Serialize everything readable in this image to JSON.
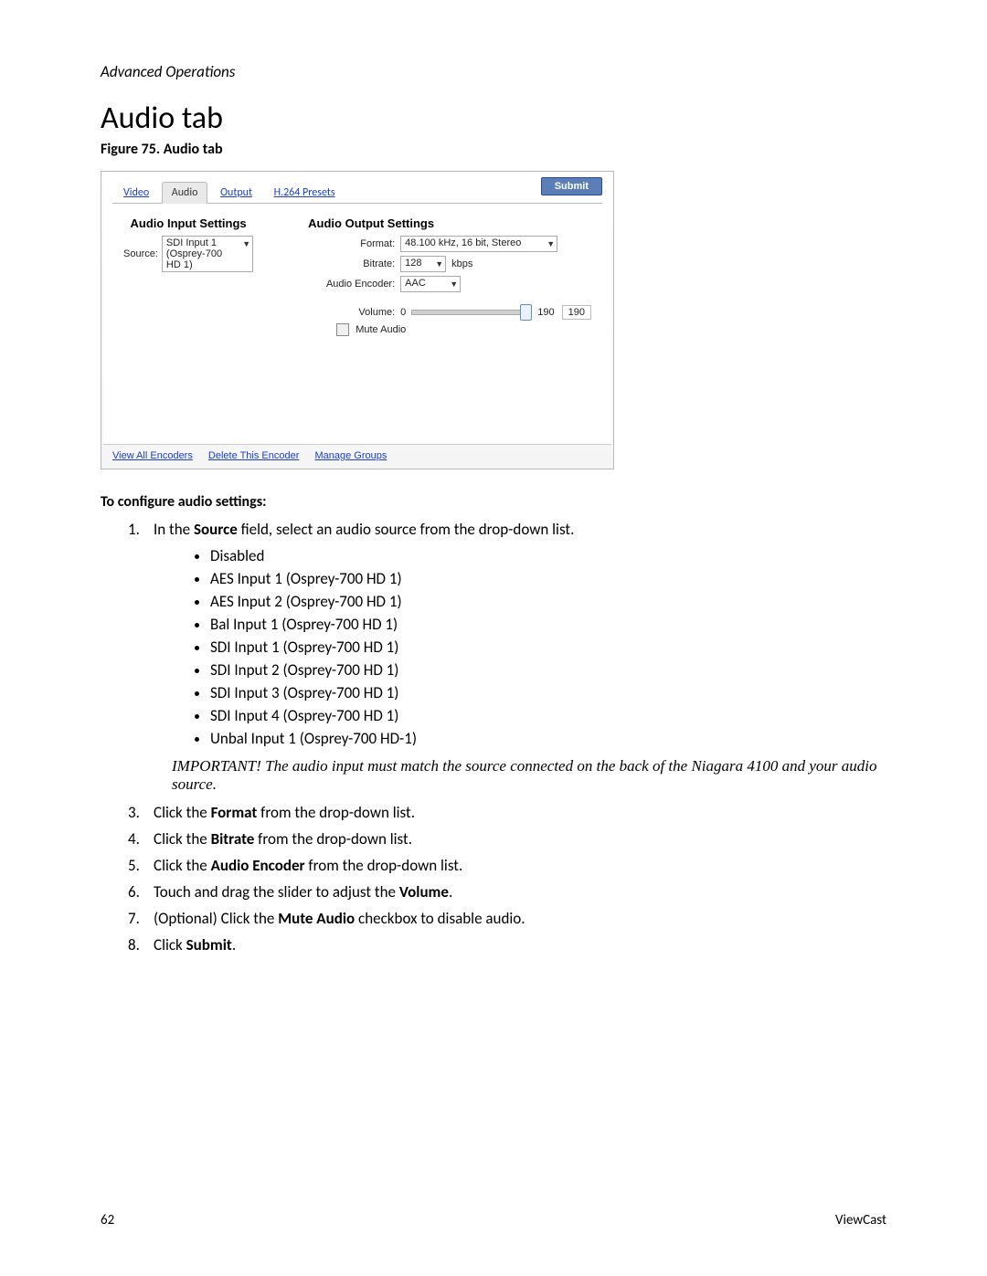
{
  "header": {
    "running": "Advanced Operations"
  },
  "title": "Audio tab",
  "figure_caption": "Figure 75. Audio tab",
  "screenshot": {
    "tabs": {
      "video": "Video",
      "audio": "Audio",
      "output": "Output",
      "presets": "H.264 Presets"
    },
    "submit": "Submit",
    "input": {
      "title": "Audio Input Settings",
      "source_label": "Source:",
      "source_value": "SDI Input 1 (Osprey-700 HD 1)"
    },
    "output": {
      "title": "Audio Output Settings",
      "format_label": "Format:",
      "format_value": "48.100 kHz, 16 bit, Stereo",
      "bitrate_label": "Bitrate:",
      "bitrate_value": "128",
      "bitrate_unit": "kbps",
      "encoder_label": "Audio Encoder:",
      "encoder_value": "AAC",
      "volume_label": "Volume:",
      "volume_min": "0",
      "volume_val": "190",
      "volume_max": "190",
      "mute_label": "Mute Audio"
    },
    "links": {
      "all": "View All Encoders",
      "delete": "Delete This Encoder",
      "groups": "Manage Groups"
    }
  },
  "instructions": {
    "heading": "To configure audio settings:",
    "step1_a": "In the ",
    "step1_b": "Source",
    "step1_c": " field, select an audio source from the drop-down list.",
    "options": [
      "Disabled",
      "AES Input 1 (Osprey-700 HD 1)",
      "AES Input 2 (Osprey-700 HD 1)",
      "Bal Input 1 (Osprey-700 HD 1)",
      "SDI Input 1 (Osprey-700 HD 1)",
      "SDI Input 2 (Osprey-700 HD 1)",
      "SDI Input 3 (Osprey-700 HD 1)",
      "SDI Input 4 (Osprey-700 HD 1)",
      "Unbal Input 1 (Osprey-700 HD-1)"
    ],
    "important": "IMPORTANT! The audio input must match the source connected on the back of the Niagara 4100 and your audio source.",
    "step3_a": "Click the ",
    "step3_b": "Format",
    "step3_c": " from the drop-down list.",
    "step4_a": "Click the ",
    "step4_b": "Bitrate",
    "step4_c": " from the drop-down list.",
    "step5_a": "Click the ",
    "step5_b": "Audio Encoder",
    "step5_c": " from the drop-down list.",
    "step6_a": "Touch and drag the slider to adjust the ",
    "step6_b": "Volume",
    "step6_c": ".",
    "step7_a": "(Optional) Click the ",
    "step7_b": "Mute Audio",
    "step7_c": " checkbox to disable audio.",
    "step8_a": "Click ",
    "step8_b": "Submit",
    "step8_c": "."
  },
  "footer": {
    "page": "62",
    "brand": "ViewCast"
  }
}
